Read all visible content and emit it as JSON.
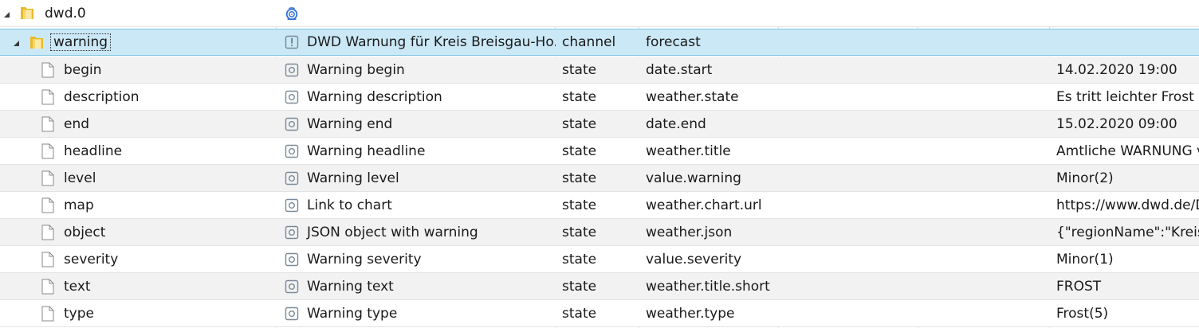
{
  "root": {
    "name": "dwd.0"
  },
  "channel": {
    "name": "warning",
    "title": "DWD Warnung für Kreis Breisgau-Ho...",
    "type": "channel",
    "role": "forecast"
  },
  "states": [
    {
      "name": "begin",
      "title": "Warning begin",
      "type": "state",
      "role": "date.start",
      "value": "14.02.2020 19:00"
    },
    {
      "name": "description",
      "title": "Warning description",
      "type": "state",
      "role": "weather.state",
      "value": "Es tritt leichter Frost bi"
    },
    {
      "name": "end",
      "title": "Warning end",
      "type": "state",
      "role": "date.end",
      "value": "15.02.2020 09:00"
    },
    {
      "name": "headline",
      "title": "Warning headline",
      "type": "state",
      "role": "weather.title",
      "value": "Amtliche WARNUNG v"
    },
    {
      "name": "level",
      "title": "Warning level",
      "type": "state",
      "role": "value.warning",
      "value": "Minor(2)"
    },
    {
      "name": "map",
      "title": "Link to chart",
      "type": "state",
      "role": "weather.chart.url",
      "value": "https://www.dwd.de/D"
    },
    {
      "name": "object",
      "title": "JSON object with warning",
      "type": "state",
      "role": "weather.json",
      "value": "{\"regionName\":\"Kreis B"
    },
    {
      "name": "severity",
      "title": "Warning severity",
      "type": "state",
      "role": "value.severity",
      "value": "Minor(1)"
    },
    {
      "name": "text",
      "title": "Warning text",
      "type": "state",
      "role": "weather.title.short",
      "value": "FROST"
    },
    {
      "name": "type",
      "title": "Warning type",
      "type": "state",
      "role": "weather.type",
      "value": "Frost(5)"
    }
  ]
}
